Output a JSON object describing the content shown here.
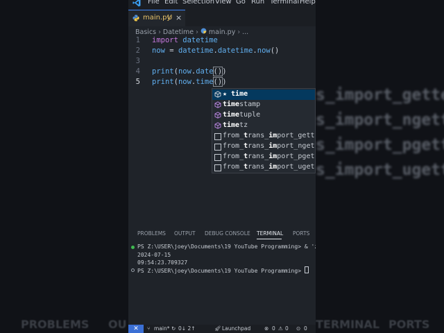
{
  "menu": [
    "File",
    "Edit",
    "Selection",
    "View",
    "Go",
    "Run",
    "Terminal",
    "Help"
  ],
  "tab": {
    "label": "main.py",
    "status": "U",
    "close": "×"
  },
  "breadcrumb": [
    "Basics",
    "Datetime",
    "main.py",
    "..."
  ],
  "code": {
    "line_numbers": [
      "1",
      "2",
      "3",
      "4",
      "5"
    ],
    "l1_kw": "import",
    "l1_mod": "datetime",
    "l2_var": "now",
    "l2_op": " = ",
    "l2_mod": "datetime",
    "l2_dot1": ".",
    "l2_cls": "datetime",
    "l2_dot2": ".",
    "l2_fn": "now",
    "l2_paren": "()",
    "l4_fn": "print",
    "l4_open": "(",
    "l4_obj": "now",
    "l4_dot": ".",
    "l4_meth": "date",
    "l4_args": "()",
    "l4_close": ")",
    "l5_fn": "print",
    "l5_open": "(",
    "l5_obj": "now",
    "l5_dot": ".",
    "l5_meth": "time",
    "l5_args": "()",
    "l5_close": ")"
  },
  "suggestions": [
    {
      "bold": "★ time",
      "rest": ""
    },
    {
      "bold": "time",
      "rest": "stamp"
    },
    {
      "bold": "time",
      "rest": "tuple"
    },
    {
      "bold": "time",
      "rest": "tz"
    },
    {
      "plain": "from_",
      "bold1": "t",
      "mid": "rans_",
      "bold2": "im",
      "end": "port_gette"
    },
    {
      "plain": "from_",
      "bold1": "t",
      "mid": "rans_",
      "bold2": "im",
      "end": "port_ngett"
    },
    {
      "plain": "from_",
      "bold1": "t",
      "mid": "rans_",
      "bold2": "im",
      "end": "port_pgett"
    },
    {
      "plain": "from_",
      "bold1": "t",
      "mid": "rans_",
      "bold2": "im",
      "end": "port_ugett"
    }
  ],
  "panel_tabs": [
    "PROBLEMS",
    "OUTPUT",
    "DEBUG CONSOLE",
    "TERMINAL",
    "PORTS"
  ],
  "terminal": [
    "PS Z:\\USER\\joey\\Documents\\19 YouTube Programming> & 'z",
    "2024-07-15",
    "09:54:23.709327",
    "PS Z:\\USER\\joey\\Documents\\19 YouTube Programming> "
  ],
  "status": {
    "remote": "✕",
    "branch": "main*",
    "sync": "0↓ 2↑",
    "launchpad": "Launchpad",
    "errors": "0",
    "warnings": "0",
    "ports": "0"
  },
  "background": {
    "right_lines": [
      "s_import_gette",
      "s_import_ngett",
      "s_import_pgett",
      "s_import_ugett"
    ],
    "bottom_left": [
      "PROBLEMS",
      "OU"
    ],
    "bottom_right": [
      "TERMINAL",
      "PORTS"
    ]
  },
  "colors": {
    "accent": "#3b82f6",
    "keyword": "#c678dd",
    "identifier": "#61afef",
    "tab_modified": "#e8c26a",
    "status_remote": "#3b6fd4",
    "selected_suggestion": "#04395e"
  }
}
